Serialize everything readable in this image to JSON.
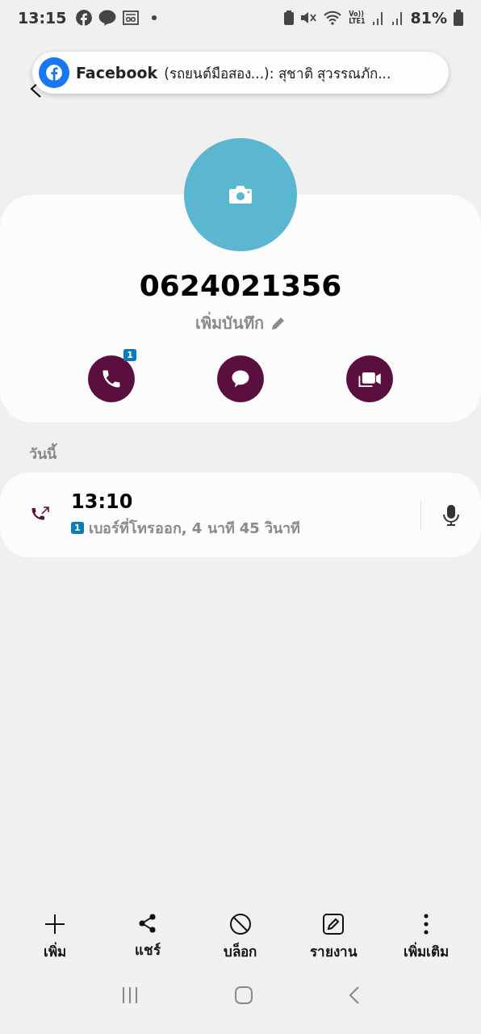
{
  "status_bar": {
    "time": "13:15",
    "volte_label": "Vo))",
    "lte_label": "LTE1",
    "battery": "81%"
  },
  "notification": {
    "app": "Facebook",
    "text": "(รถยนต์มือสอง...): สุชาติ สุวรรณภัก..."
  },
  "contact": {
    "number": "0624021356",
    "note": "เพิ่มบันทึก",
    "actions": [
      {
        "kind": "call",
        "badge": "1"
      },
      {
        "kind": "message"
      },
      {
        "kind": "video"
      }
    ]
  },
  "history": {
    "section": "วันนี้",
    "calls": [
      {
        "time": "13:10",
        "sim": "1",
        "detail": "เบอร์ที่โทรออก, 4 นาที 45 วินาที"
      }
    ]
  },
  "bottom_actions": [
    {
      "kind": "add",
      "label": "เพิ่ม"
    },
    {
      "kind": "share",
      "label": "แชร์"
    },
    {
      "kind": "block",
      "label": "บล็อก"
    },
    {
      "kind": "report",
      "label": "รายงาน"
    },
    {
      "kind": "more",
      "label": "เพิ่มเติม"
    }
  ]
}
